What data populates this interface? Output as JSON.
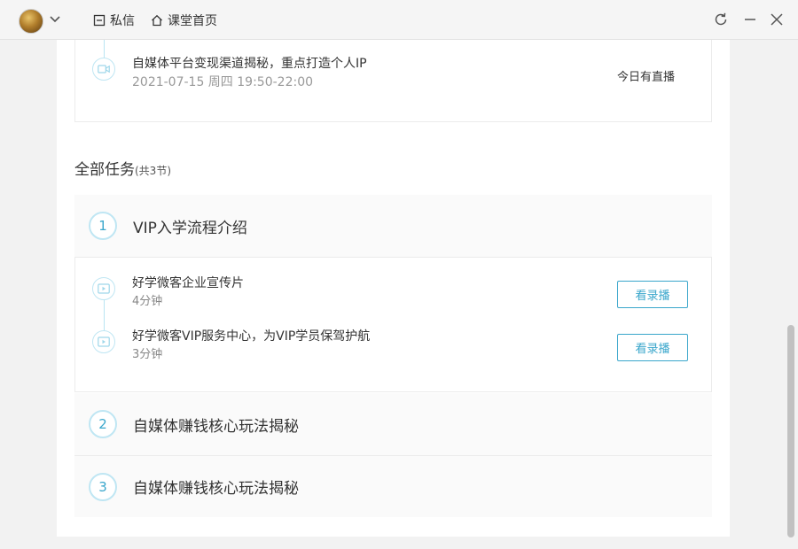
{
  "header": {
    "nav": [
      {
        "label": "私信",
        "icon": "message-icon"
      },
      {
        "label": "课堂首页",
        "icon": "home-icon"
      }
    ]
  },
  "live": {
    "title": "自媒体平台变现渠道揭秘，重点打造个人IP",
    "time": "2021-07-15 周四 19:50-22:00",
    "status": "今日有直播",
    "icon": "video-camera-icon"
  },
  "tasks": {
    "title": "全部任务",
    "count": "(共3节)",
    "chapters": [
      {
        "number": "1",
        "title": "VIP入学流程介绍",
        "lessons": [
          {
            "title": "好学微客企业宣传片",
            "duration": "4分钟",
            "action": "看录播",
            "icon": "play-video-icon"
          },
          {
            "title": "好学微客VIP服务中心，为VIP学员保驾护航",
            "duration": "3分钟",
            "action": "看录播",
            "icon": "play-video-icon"
          }
        ]
      },
      {
        "number": "2",
        "title": "自媒体赚钱核心玩法揭秘"
      },
      {
        "number": "3",
        "title": "自媒体赚钱核心玩法揭秘"
      }
    ]
  },
  "colors": {
    "accent": "#39a6cb",
    "accent_light": "#bfe6f3",
    "chapter_bg": "#fafafa"
  }
}
